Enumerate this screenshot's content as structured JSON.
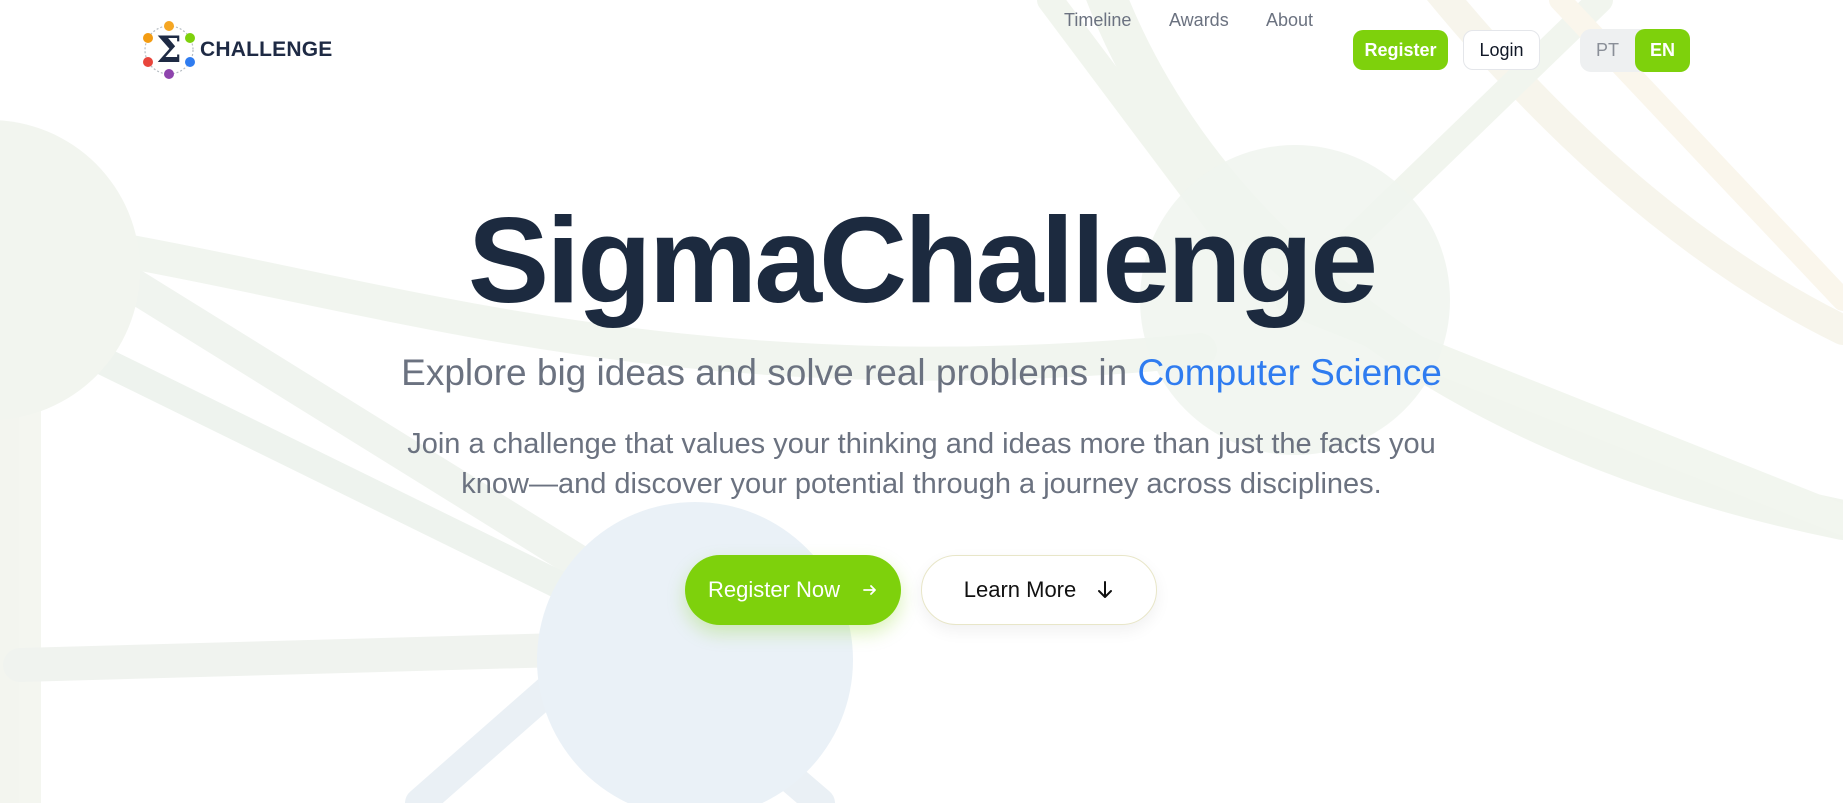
{
  "logo": {
    "text": "CHALLENGE",
    "icon": "sigma-logo-icon",
    "dot_colors": [
      "#e8453c",
      "#f5a623",
      "#7ed10c",
      "#2f7cf0",
      "#8e44ad",
      "#1abc9c"
    ]
  },
  "nav": {
    "links": [
      "Timeline",
      "Awards",
      "About"
    ],
    "register_label": "Register",
    "login_label": "Login",
    "languages": [
      "PT",
      "EN"
    ],
    "active_language": "EN"
  },
  "hero": {
    "title": "SigmaChallenge",
    "subtitle_prefix": "Explore big ideas and solve real problems in ",
    "subtitle_accent": "Computer Science",
    "description_line1": "Join a challenge that values your thinking and ideas more than just the facts you",
    "description_line2": "know—and discover your potential through a journey across disciplines.",
    "cta_primary": "Register Now",
    "cta_primary_icon": "arrow-right-icon",
    "cta_secondary": "Learn More",
    "cta_secondary_icon": "arrow-down-icon"
  },
  "colors": {
    "brand_green": "#7ed10c",
    "accent_blue": "#2f7cf0",
    "title_dark": "#1c2a3f",
    "muted_text": "#6b7280"
  }
}
